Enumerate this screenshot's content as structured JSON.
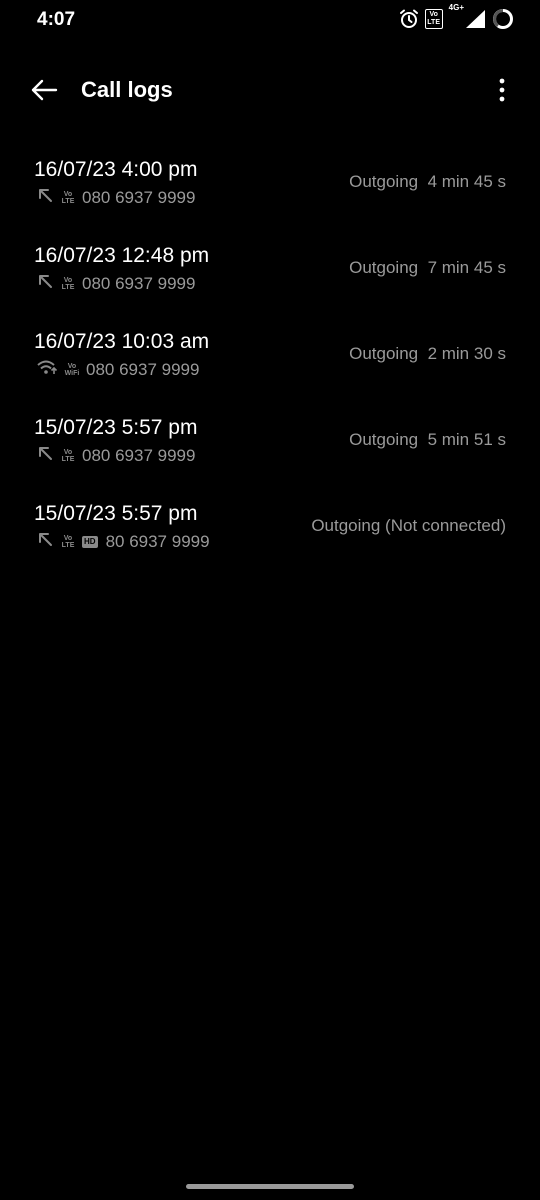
{
  "status_bar": {
    "time": "4:07",
    "volte_top": "Vo",
    "volte_bottom": "LTE",
    "network_type": "4G+",
    "icons": [
      "alarm-icon",
      "volte-icon",
      "signal-icon",
      "battery-icon"
    ]
  },
  "app_bar": {
    "title": "Call logs",
    "back_icon": "arrow-left-icon",
    "more_icon": "more-vertical-icon"
  },
  "call_logs": [
    {
      "datetime": "16/07/23 4:00 pm",
      "call_icon": "outgoing-call-icon",
      "tag_top": "Vo",
      "tag_bottom": "LTE",
      "hd": "",
      "number": "080 6937 9999",
      "status": "Outgoing  4 min 45 s"
    },
    {
      "datetime": "16/07/23 12:48 pm",
      "call_icon": "outgoing-call-icon",
      "tag_top": "Vo",
      "tag_bottom": "LTE",
      "hd": "",
      "number": "080 6937 9999",
      "status": "Outgoing  7 min 45 s"
    },
    {
      "datetime": "16/07/23 10:03 am",
      "call_icon": "wifi-call-icon",
      "tag_top": "Vo",
      "tag_bottom": "WiFi",
      "hd": "",
      "number": "080 6937 9999",
      "status": "Outgoing  2 min 30 s"
    },
    {
      "datetime": "15/07/23 5:57 pm",
      "call_icon": "outgoing-call-icon",
      "tag_top": "Vo",
      "tag_bottom": "LTE",
      "hd": "",
      "number": "080 6937 9999",
      "status": "Outgoing  5 min 51 s"
    },
    {
      "datetime": "15/07/23 5:57 pm",
      "call_icon": "outgoing-call-icon",
      "tag_top": "Vo",
      "tag_bottom": "LTE",
      "hd": "HD",
      "number": "80 6937 9999",
      "status": "Outgoing (Not connected)"
    }
  ],
  "colors": {
    "background": "#000000",
    "primary_text": "#ffffff",
    "secondary_text": "#9a9a9a"
  }
}
